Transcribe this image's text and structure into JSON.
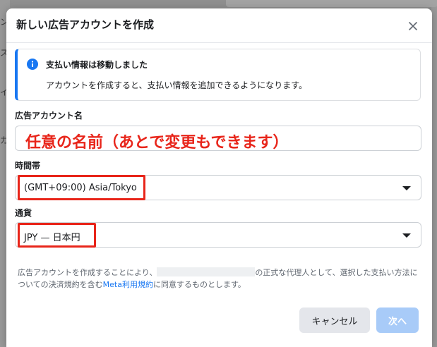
{
  "background": {
    "left_glyphs": [
      "ン",
      "ス",
      "イ",
      "カ"
    ]
  },
  "dialog": {
    "title": "新しい広告アカウントを作成",
    "close_icon": "close-icon"
  },
  "info": {
    "icon": "info-icon",
    "title": "支払い情報は移動しました",
    "text": "アカウントを作成すると、支払い情報を追加できるようになります。"
  },
  "account_name": {
    "label": "広告アカウント名",
    "value": "",
    "annotation": "任意の名前（あとで変更もできます）"
  },
  "timezone": {
    "label": "時間帯",
    "value": "(GMT+09:00) Asia/Tokyo"
  },
  "currency": {
    "label": "通貨",
    "value": "JPY — 日本円"
  },
  "terms": {
    "part1": "広告アカウントを作成することにより、",
    "part2": "の正式な代理人として、選択した支払い方法についての決済規約を含む",
    "link": "Meta利用規約",
    "part3": "に同意するものとします。"
  },
  "buttons": {
    "cancel": "キャンセル",
    "next": "次へ"
  },
  "colors": {
    "accent": "#1877f2",
    "annotation_red": "#e8251a",
    "disabled_button": "#a8cbf8"
  }
}
